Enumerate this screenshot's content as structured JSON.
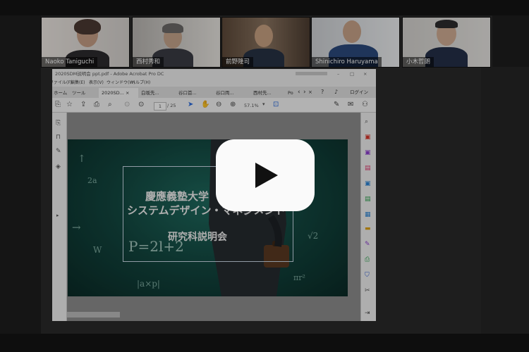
{
  "participants": [
    {
      "name": "Naoko Taniguchi"
    },
    {
      "name": "西村秀和"
    },
    {
      "name": "前野隆司"
    },
    {
      "name": "Shinichiro Haruyama"
    },
    {
      "name": "小木哲朗"
    }
  ],
  "acrobat": {
    "window_title": "2020SDM説明会 ppt.pdf - Adobe Acrobat Pro DC",
    "menu": [
      "ファイル(F)",
      "編集(E)",
      "表示(V)",
      "ウィンドウ(W)",
      "ヘルプ(H)"
    ],
    "tabs": [
      "ホーム",
      "ツール",
      "2020SD...",
      "白坂先...",
      "谷口首...",
      "谷口両...",
      "西村先..."
    ],
    "tab_more": "Po",
    "login": "ログイン",
    "page_current": "1",
    "page_total": "/ 25",
    "zoom": "57.1%"
  },
  "slide": {
    "title_line1": "慶應義塾大学",
    "title_line2": "システムデザイン・マネジメント",
    "subtitle": "研究科説明会",
    "formula": "P=2l+2"
  },
  "icons": {
    "play": "play-button-icon"
  }
}
